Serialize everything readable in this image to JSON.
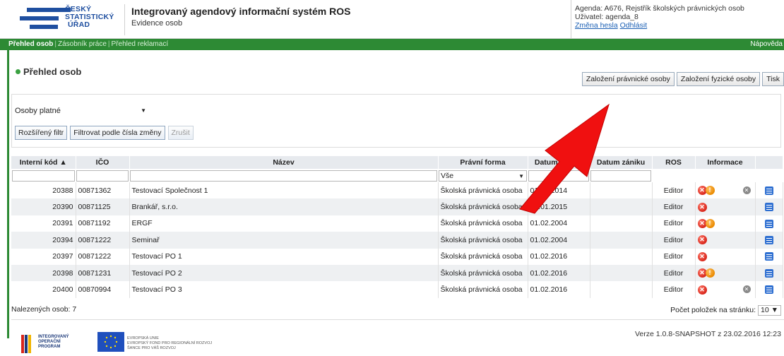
{
  "header": {
    "logo_lines": [
      "ČESKÝ",
      "STATISTICKÝ",
      "ÚŘAD"
    ],
    "app_title": "Integrovaný agendový informační systém ROS",
    "app_subtitle": "Evidence osob",
    "agenda": "Agenda: A676, Rejstřík školských právnických osob",
    "user": "Uživatel: agenda_8",
    "change_password": "Změna hesla",
    "logout": "Odhlásit"
  },
  "nav": {
    "items": [
      "Přehled osob",
      "Zásobník práce",
      "Přehled reklamací"
    ],
    "help": "Nápověda"
  },
  "page": {
    "title": "Přehled osob",
    "buttons": [
      "Založení právnické osoby",
      "Založení fyzické osoby",
      "Tisk"
    ]
  },
  "filter": {
    "select_value": "Osoby platné",
    "buttons": [
      "Rozšířený filtr",
      "Filtrovat podle čísla změny",
      "Zrušit"
    ]
  },
  "table": {
    "columns": [
      "Interní kód ▲",
      "IČO",
      "Název",
      "Právní forma",
      "Datum vzniku",
      "Datum zániku",
      "ROS",
      "Informace",
      ""
    ],
    "filter_select": "Vše",
    "rows": [
      {
        "kod": "20388",
        "ico": "00871362",
        "nazev": "Testovací Společnost 1",
        "forma": "Školská právnická osoba",
        "vznik": "01.04.2014",
        "zanik": "",
        "ros": "Editor",
        "info": [
          "error",
          "warning",
          "closed"
        ]
      },
      {
        "kod": "20390",
        "ico": "00871125",
        "nazev": "Brankář, s.r.o.",
        "forma": "Školská právnická osoba",
        "vznik": "01.01.2015",
        "zanik": "",
        "ros": "Editor",
        "info": [
          "error"
        ]
      },
      {
        "kod": "20391",
        "ico": "00871192",
        "nazev": "ERGF",
        "forma": "Školská právnická osoba",
        "vznik": "01.02.2004",
        "zanik": "",
        "ros": "Editor",
        "info": [
          "error",
          "warning"
        ]
      },
      {
        "kod": "20394",
        "ico": "00871222",
        "nazev": "Seminař",
        "forma": "Školská právnická osoba",
        "vznik": "01.02.2004",
        "zanik": "",
        "ros": "Editor",
        "info": [
          "error"
        ]
      },
      {
        "kod": "20397",
        "ico": "00871222",
        "nazev": "Testovací PO 1",
        "forma": "Školská právnická osoba",
        "vznik": "01.02.2016",
        "zanik": "",
        "ros": "Editor",
        "info": [
          "error"
        ]
      },
      {
        "kod": "20398",
        "ico": "00871231",
        "nazev": "Testovací PO 2",
        "forma": "Školská právnická osoba",
        "vznik": "01.02.2016",
        "zanik": "",
        "ros": "Editor",
        "info": [
          "error",
          "warning"
        ]
      },
      {
        "kod": "20400",
        "ico": "00870994",
        "nazev": "Testovací PO 3",
        "forma": "Školská právnická osoba",
        "vznik": "01.02.2016",
        "zanik": "",
        "ros": "Editor",
        "info": [
          "error",
          "closed"
        ]
      }
    ]
  },
  "footer": {
    "found": "Nalezených osob: 7",
    "per_page_label": "Počet položek na stránku:",
    "per_page_value": "10",
    "version": "Verze 1.0.8-SNAPSHOT z 23.02.2016 12:23",
    "op_logo_lines": [
      "INTEGROVANÝ",
      "OPERAČNÍ",
      "PROGRAM"
    ],
    "eu_lines": [
      "EVROPSKÁ UNIE",
      "EVROPSKÝ FOND PRO REGIONÁLNÍ ROZVOJ",
      "ŠANCE PRO VÁŠ ROZVOJ"
    ]
  },
  "colors": {
    "nav_green": "#2d8a34",
    "brand_blue": "#1f4fa0",
    "error_red": "#d8261b",
    "warning_orange": "#ea8a00",
    "annotation_arrow": "#f01010"
  }
}
